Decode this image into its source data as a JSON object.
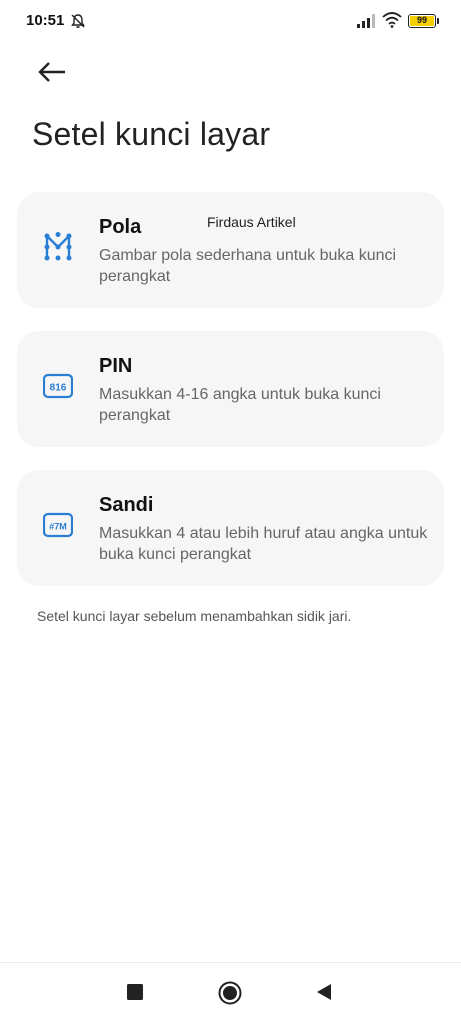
{
  "status_bar": {
    "time": "10:51",
    "battery_level": "99",
    "battery_color": "#f5d000",
    "icons": [
      "bell-off-icon",
      "signal-icon",
      "wifi-icon",
      "battery-icon"
    ]
  },
  "header": {
    "back_icon": "arrow-left-icon",
    "title": "Setel kunci layar"
  },
  "watermark": "Firdaus Artikel",
  "options": [
    {
      "icon": "pattern-icon",
      "title": "Pola",
      "description": "Gambar pola sederhana untuk buka kunci perangkat"
    },
    {
      "icon": "pin-icon",
      "icon_text": "816",
      "title": "PIN",
      "description": "Masukkan 4-16 angka untuk buka kunci perangkat"
    },
    {
      "icon": "password-icon",
      "icon_text": "#7M",
      "title": "Sandi",
      "description": "Masukkan 4 atau lebih huruf atau angka untuk buka kunci perangkat"
    }
  ],
  "footer_note": "Setel kunci layar sebelum menambahkan sidik jari.",
  "accent_color": "#2a7fd4",
  "nav_bar": {
    "icons": [
      "recents-square-icon",
      "home-circle-icon",
      "back-triangle-icon"
    ]
  }
}
